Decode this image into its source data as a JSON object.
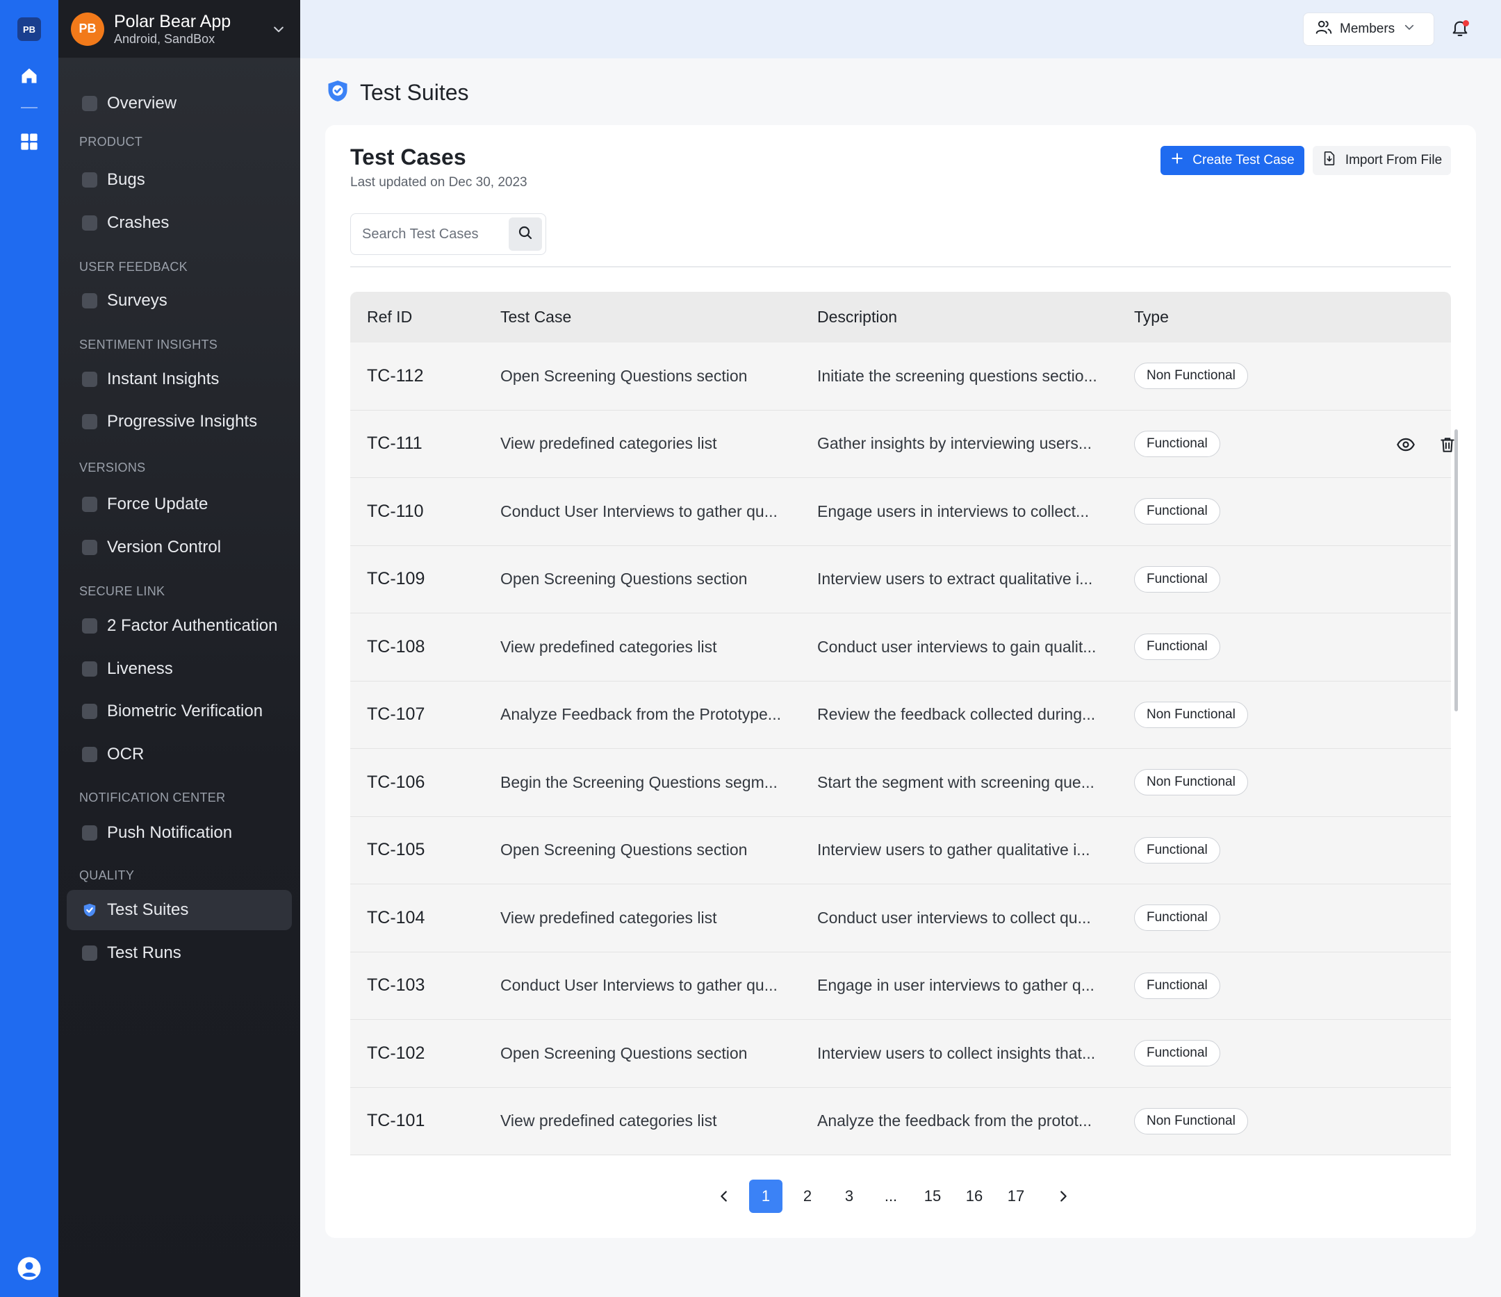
{
  "rail": {
    "logo": "PB",
    "icons": [
      "home-icon",
      "grid-icon",
      "user-circle-icon"
    ]
  },
  "app": {
    "avatar": "PB",
    "name": "Polar Bear App",
    "subtitle": "Android, SandBox"
  },
  "nav": {
    "overview": "Overview",
    "sections": {
      "product": "PRODUCT",
      "user_feedback": "USER FEEDBACK",
      "sentiment": "SENTIMENT INSIGHTS",
      "versions": "VERSIONS",
      "secure_link": "SECURE LINK",
      "notification": "NOTIFICATION CENTER",
      "quality": "QUALITY"
    },
    "items": {
      "bugs": "Bugs",
      "crashes": "Crashes",
      "surveys": "Surveys",
      "instant_insights": "Instant Insights",
      "progressive_insights": "Progressive Insights",
      "force_update": "Force Update",
      "version_control": "Version Control",
      "two_factor": "2 Factor Authentication",
      "liveness": "Liveness",
      "biometric": "Biometric Verification",
      "ocr": "OCR",
      "push_notification": "Push Notification",
      "test_suites": "Test Suites",
      "test_runs": "Test Runs"
    },
    "active": "test_suites"
  },
  "topbar": {
    "members_label": "Members",
    "has_notification": true
  },
  "page": {
    "title": "Test Suites"
  },
  "card": {
    "title": "Test Cases",
    "subtitle": "Last updated on Dec 30, 2023",
    "create_label": "Create Test Case",
    "import_label": "Import From File",
    "search_placeholder": "Search Test Cases"
  },
  "table": {
    "headers": {
      "ref_id": "Ref ID",
      "test_case": "Test Case",
      "description": "Description",
      "type": "Type"
    },
    "rows": [
      {
        "ref": "TC-112",
        "test_case": "Open Screening Questions section",
        "description": "Initiate the screening questions sectio...",
        "type": "Non Functional"
      },
      {
        "ref": "TC-111",
        "test_case": "View predefined categories list",
        "description": "Gather insights by interviewing users...",
        "type": "Functional"
      },
      {
        "ref": "TC-110",
        "test_case": "Conduct User Interviews to gather qu...",
        "description": "Engage users in interviews to collect...",
        "type": "Functional"
      },
      {
        "ref": "TC-109",
        "test_case": "Open Screening Questions section",
        "description": "Interview users to extract qualitative i...",
        "type": "Functional"
      },
      {
        "ref": "TC-108",
        "test_case": "View predefined categories list",
        "description": "Conduct user interviews to gain qualit...",
        "type": "Functional"
      },
      {
        "ref": "TC-107",
        "test_case": "Analyze Feedback from the Prototype...",
        "description": "Review the feedback collected during...",
        "type": "Non Functional"
      },
      {
        "ref": "TC-106",
        "test_case": "Begin the Screening Questions segm...",
        "description": "Start the segment with screening que...",
        "type": "Non Functional"
      },
      {
        "ref": "TC-105",
        "test_case": "Open Screening Questions section",
        "description": "Interview users to gather qualitative i...",
        "type": "Functional"
      },
      {
        "ref": "TC-104",
        "test_case": "View predefined categories list",
        "description": "Conduct user interviews to collect qu...",
        "type": "Functional"
      },
      {
        "ref": "TC-103",
        "test_case": "Conduct User Interviews to gather qu...",
        "description": "Engage in user interviews to gather q...",
        "type": "Functional"
      },
      {
        "ref": "TC-102",
        "test_case": "Open Screening Questions section",
        "description": "Interview users to collect insights that...",
        "type": "Functional"
      },
      {
        "ref": "TC-101",
        "test_case": "View predefined categories list",
        "description": "Analyze the feedback from the protot...",
        "type": "Non Functional"
      }
    ],
    "hovered_row": 1
  },
  "pagination": {
    "pages": [
      "1",
      "2",
      "3",
      "...",
      "15",
      "16",
      "17"
    ],
    "current": "1"
  },
  "colors": {
    "rail": "#1f6bf0",
    "primary": "#1f6bf0",
    "active_page": "#3b82f6",
    "app_avatar": "#f27a1a",
    "sidebar": "#1c1e24"
  }
}
